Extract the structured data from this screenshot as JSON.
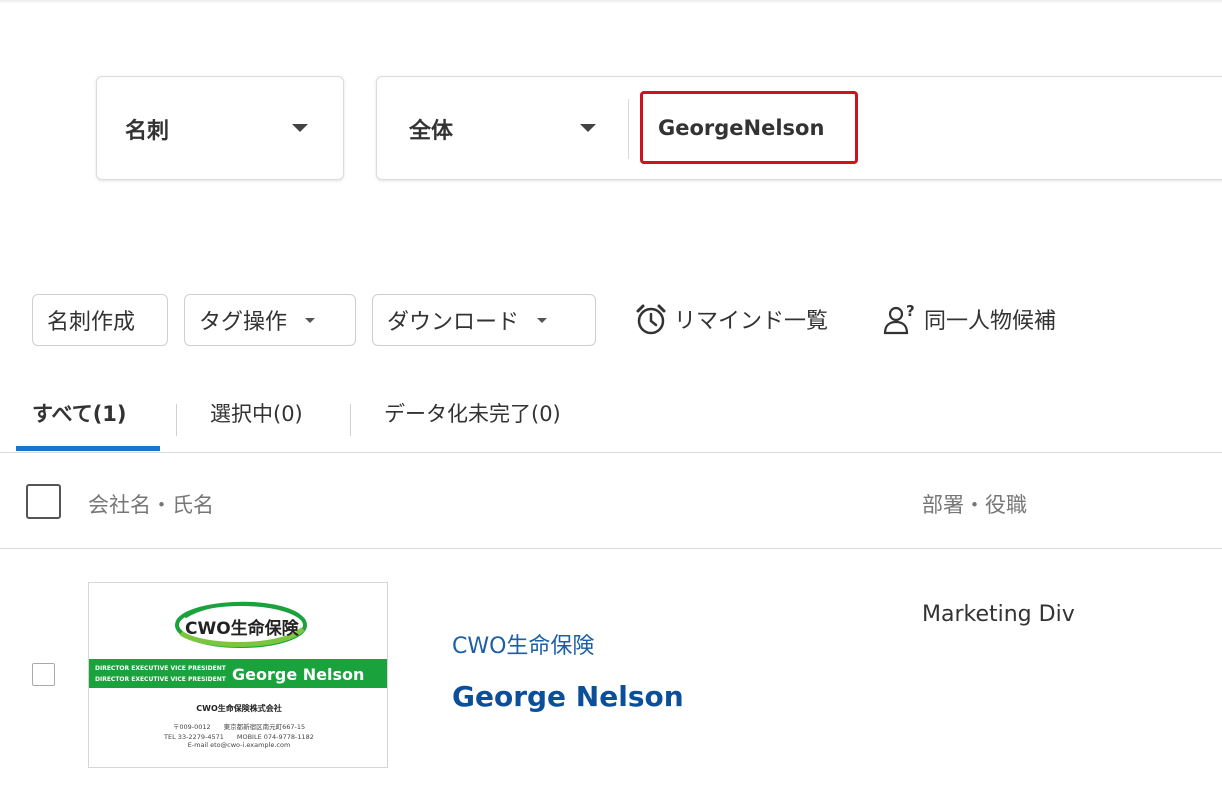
{
  "search": {
    "category_select": "名刺",
    "scope_select": "全体",
    "query": "GeorgeNelson"
  },
  "toolbar": {
    "create_card": "名刺作成",
    "tag_ops": "タグ操作",
    "download": "ダウンロード",
    "remind_list": "リマインド一覧",
    "same_person": "同一人物候補"
  },
  "tabs": {
    "all": "すべて(1)",
    "selected": "選択中(0)",
    "incomplete": "データ化未完了(0)"
  },
  "table": {
    "header_company_name": "会社名・氏名",
    "header_dept_title": "部署・役職",
    "rows": [
      {
        "company": "CWO生命保険",
        "name": "George Nelson",
        "department": "Marketing Div",
        "card": {
          "logo_text": "CWO生命保険",
          "title_line1": "DIRECTOR EXECUTIVE VICE PRESIDENT",
          "title_line2": "DIRECTOR EXECUTIVE VICE PRESIDENT",
          "name": "George Nelson",
          "company_full": "CWO生命保険株式会社",
          "address": "〒009-0012　　東京都新宿区南元町667-15",
          "phones": "TEL 33-2279-4571　　MOBILE 074-9778-1182",
          "email": "E-mail eto@cwo-i.example.com"
        }
      }
    ]
  },
  "colors": {
    "accent_blue": "#1e72c8",
    "link_blue": "#1b5fa8",
    "highlight_red": "#d0121b",
    "card_green": "#1aa33d"
  }
}
